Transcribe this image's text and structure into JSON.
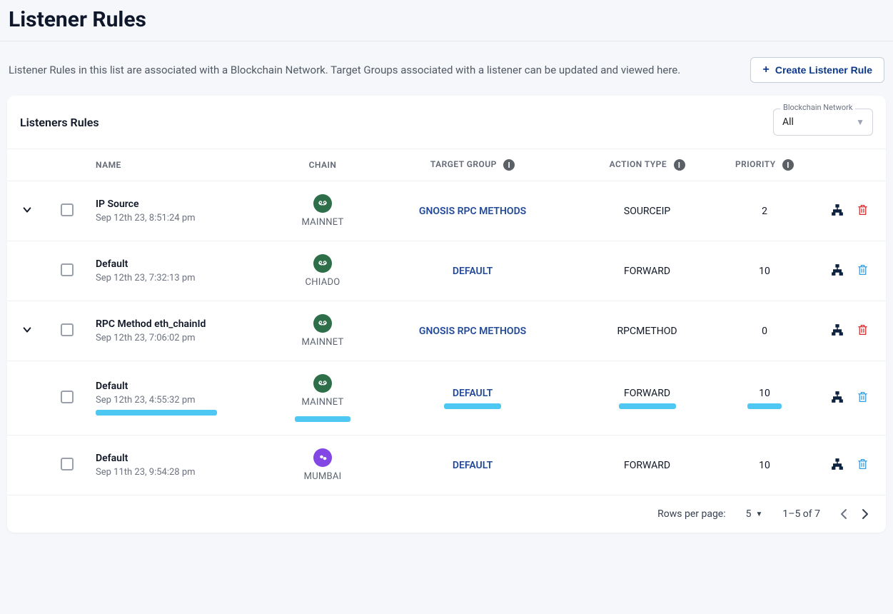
{
  "header": {
    "title": "Listener Rules"
  },
  "intro": {
    "text": "Listener Rules in this list are associated with a Blockchain Network. Target Groups associated with a listener can be updated and viewed here.",
    "create_label": "Create Listener Rule"
  },
  "card": {
    "title": "Listeners Rules",
    "filter_legend": "Blockchain Network",
    "filter_value": "All"
  },
  "columns": {
    "name": "NAME",
    "chain": "CHAIN",
    "target_group": "TARGET GROUP",
    "action_type": "ACTION TYPE",
    "priority": "PRIORITY"
  },
  "rows": [
    {
      "expandable": true,
      "name": "IP Source",
      "ts": "Sep 12th 23, 8:51:24 pm",
      "chain_icon": "gnosis",
      "chain_label": "MAINNET",
      "target_group": "GNOSIS RPC METHODS",
      "action_type": "SOURCEIP",
      "priority": "2",
      "trash": "red",
      "highlight": false
    },
    {
      "expandable": false,
      "name": "Default",
      "ts": "Sep 12th 23, 7:32:13 pm",
      "chain_icon": "gnosis",
      "chain_label": "CHIADO",
      "target_group": "DEFAULT",
      "action_type": "FORWARD",
      "priority": "10",
      "trash": "blue",
      "highlight": false
    },
    {
      "expandable": true,
      "name": "RPC Method eth_chainId",
      "ts": "Sep 12th 23, 7:06:02 pm",
      "chain_icon": "gnosis",
      "chain_label": "MAINNET",
      "target_group": "GNOSIS RPC METHODS",
      "action_type": "RPCMETHOD",
      "priority": "0",
      "trash": "red",
      "highlight": false
    },
    {
      "expandable": false,
      "name": "Default",
      "ts": "Sep 12th 23, 4:55:32 pm",
      "chain_icon": "gnosis",
      "chain_label": "MAINNET",
      "target_group": "DEFAULT",
      "action_type": "FORWARD",
      "priority": "10",
      "trash": "blue",
      "highlight": true
    },
    {
      "expandable": false,
      "name": "Default",
      "ts": "Sep 11th 23, 9:54:28 pm",
      "chain_icon": "polygon",
      "chain_label": "MUMBAI",
      "target_group": "DEFAULT",
      "action_type": "FORWARD",
      "priority": "10",
      "trash": "blue",
      "highlight": false
    }
  ],
  "pager": {
    "rows_label": "Rows per page:",
    "rows_value": "5",
    "range": "1–5 of 7"
  }
}
